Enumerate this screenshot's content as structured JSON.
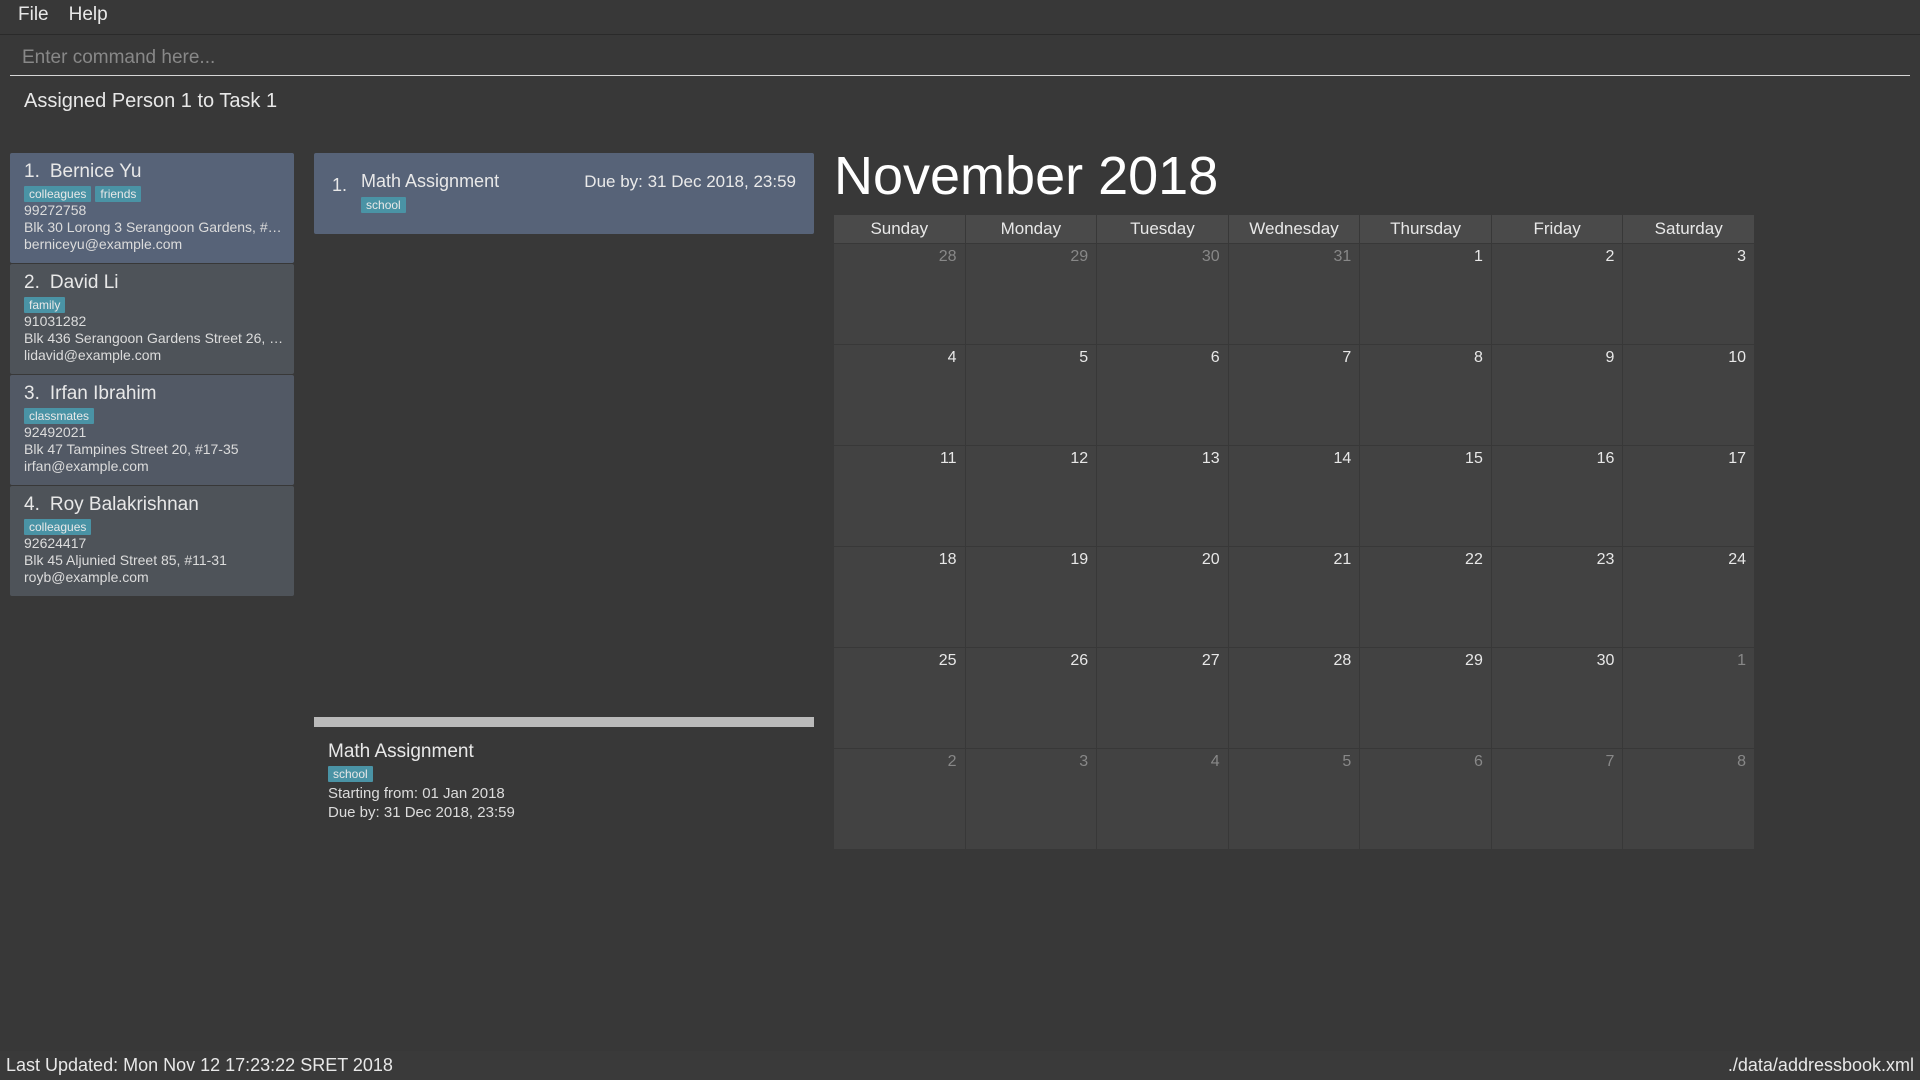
{
  "menu": {
    "file": "File",
    "help": "Help"
  },
  "command": {
    "placeholder": "Enter command here..."
  },
  "status": "Assigned Person 1 to Task 1",
  "persons": [
    {
      "idx": "1.",
      "name": "Bernice Yu",
      "tags": [
        "colleagues",
        "friends"
      ],
      "phone": "99272758",
      "addr": "Blk 30 Lorong 3 Serangoon Gardens, #…",
      "email": "berniceyu@example.com"
    },
    {
      "idx": "2.",
      "name": "David Li",
      "tags": [
        "family"
      ],
      "phone": "91031282",
      "addr": "Blk 436 Serangoon Gardens Street 26, …",
      "email": "lidavid@example.com"
    },
    {
      "idx": "3.",
      "name": "Irfan Ibrahim",
      "tags": [
        "classmates"
      ],
      "phone": "92492021",
      "addr": "Blk 47 Tampines Street 20, #17-35",
      "email": "irfan@example.com"
    },
    {
      "idx": "4.",
      "name": "Roy Balakrishnan",
      "tags": [
        "colleagues"
      ],
      "phone": "92624417",
      "addr": "Blk 45 Aljunied Street 85, #11-31",
      "email": "royb@example.com"
    }
  ],
  "tasks": [
    {
      "idx": "1.",
      "title": "Math Assignment",
      "tags": [
        "school"
      ],
      "due": "Due by: 31 Dec 2018, 23:59"
    }
  ],
  "task_detail": {
    "title": "Math Assignment",
    "tags": [
      "school"
    ],
    "start": "Starting from: 01 Jan 2018",
    "due": "Due by: 31 Dec 2018, 23:59"
  },
  "calendar": {
    "title": "November 2018",
    "days": [
      "Sunday",
      "Monday",
      "Tuesday",
      "Wednesday",
      "Thursday",
      "Friday",
      "Saturday"
    ],
    "cells": [
      {
        "d": "28",
        "dim": true
      },
      {
        "d": "29",
        "dim": true
      },
      {
        "d": "30",
        "dim": true
      },
      {
        "d": "31",
        "dim": true
      },
      {
        "d": "1"
      },
      {
        "d": "2"
      },
      {
        "d": "3"
      },
      {
        "d": "4"
      },
      {
        "d": "5"
      },
      {
        "d": "6"
      },
      {
        "d": "7"
      },
      {
        "d": "8"
      },
      {
        "d": "9"
      },
      {
        "d": "10"
      },
      {
        "d": "11"
      },
      {
        "d": "12"
      },
      {
        "d": "13"
      },
      {
        "d": "14"
      },
      {
        "d": "15"
      },
      {
        "d": "16"
      },
      {
        "d": "17"
      },
      {
        "d": "18"
      },
      {
        "d": "19"
      },
      {
        "d": "20"
      },
      {
        "d": "21"
      },
      {
        "d": "22"
      },
      {
        "d": "23"
      },
      {
        "d": "24"
      },
      {
        "d": "25"
      },
      {
        "d": "26"
      },
      {
        "d": "27"
      },
      {
        "d": "28"
      },
      {
        "d": "29"
      },
      {
        "d": "30"
      },
      {
        "d": "1",
        "dim": true
      },
      {
        "d": "2",
        "dim": true
      },
      {
        "d": "3",
        "dim": true
      },
      {
        "d": "4",
        "dim": true
      },
      {
        "d": "5",
        "dim": true
      },
      {
        "d": "6",
        "dim": true
      },
      {
        "d": "7",
        "dim": true
      },
      {
        "d": "8",
        "dim": true
      }
    ]
  },
  "footer": {
    "left": "Last Updated: Mon Nov 12 17:23:22 SRET 2018",
    "right": "./data/addressbook.xml"
  }
}
